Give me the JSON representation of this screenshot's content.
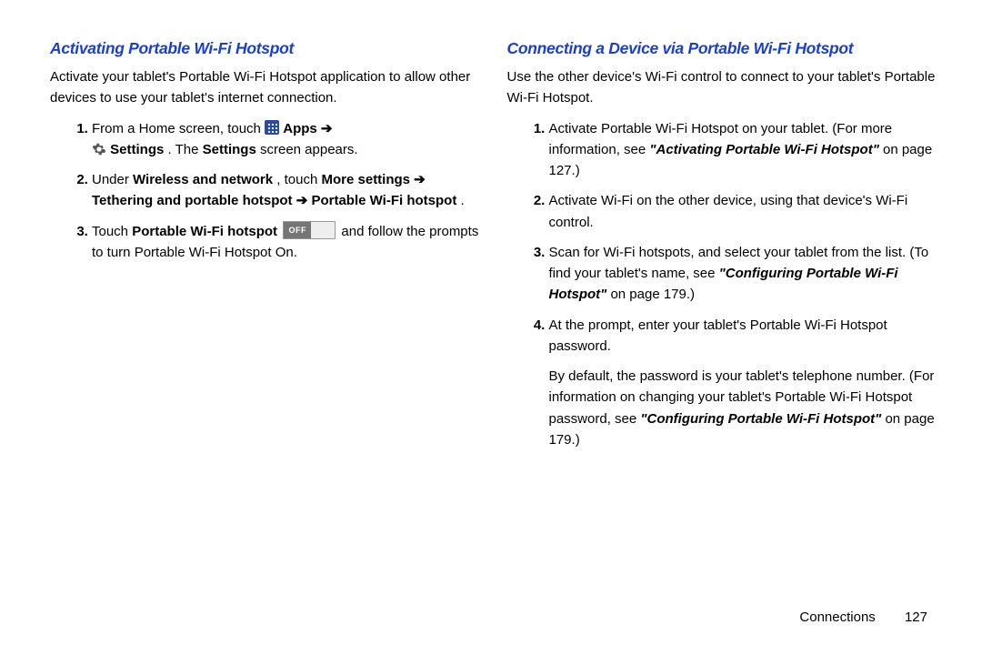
{
  "left": {
    "title": "Activating Portable Wi-Fi Hotspot",
    "intro": "Activate your tablet's Portable Wi-Fi Hotspot application to allow other devices to use your tablet's internet connection.",
    "step1_a": "From a Home screen, touch ",
    "step1_apps": "Apps",
    "step1_b": "Settings",
    "step1_c": ". The ",
    "step1_d": "Settings",
    "step1_e": " screen appears.",
    "step2_a": "Under ",
    "step2_b": "Wireless and network",
    "step2_c": ", touch ",
    "step2_d": "More settings",
    "step2_e": "Tethering and portable hotspot",
    "step2_f": "Portable Wi-Fi hotspot",
    "step2_g": ".",
    "step3_a": "Touch ",
    "step3_b": "Portable Wi-Fi hotspot",
    "step3_c": " and follow the prompts to turn Portable Wi-Fi Hotspot On."
  },
  "right": {
    "title": "Connecting a Device via Portable Wi-Fi Hotspot",
    "intro": "Use the other device's Wi-Fi control to connect to your tablet's Portable Wi-Fi Hotspot.",
    "step1_a": "Activate Portable Wi-Fi Hotspot on your tablet. (For more information, see ",
    "step1_b": "\"Activating Portable Wi-Fi Hotspot\"",
    "step1_c": " on page 127.)",
    "step2": "Activate Wi-Fi on the other device, using that device's Wi-Fi control.",
    "step3_a": "Scan for Wi-Fi hotspots, and select your tablet from the list. (To find your tablet's name, see ",
    "step3_b": "\"Configuring Portable Wi-Fi Hotspot\"",
    "step3_c": " on page 179.)",
    "step4": "At the prompt, enter your tablet's Portable Wi-Fi Hotspot password.",
    "after_a": "By default, the password is your tablet's telephone number. (For information on changing your tablet's Portable Wi-Fi Hotspot password, see ",
    "after_b": "\"Configuring Portable Wi-Fi Hotspot\"",
    "after_c": " on page 179.)"
  },
  "footer": {
    "section": "Connections",
    "page": "127"
  }
}
